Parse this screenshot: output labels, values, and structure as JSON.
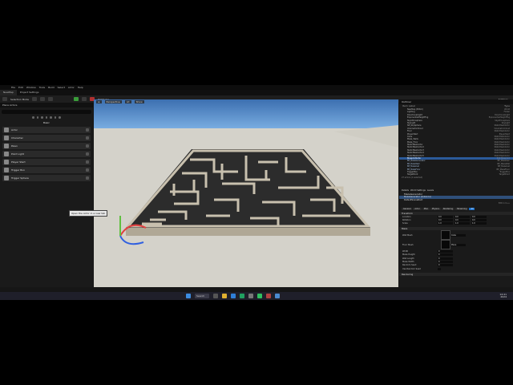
{
  "window": {
    "project": "UnrealEditor",
    "menu": [
      "File",
      "Edit",
      "Window",
      "Tools",
      "Build",
      "Select",
      "Actor",
      "Help"
    ],
    "tabs": [
      "NewMap",
      "Project Settings"
    ],
    "active_tab": "NewMap"
  },
  "toolbar": {
    "mode_label": "Selection Mode",
    "platforms_label": "Platforms",
    "settings_label": "Settings"
  },
  "place_actors": {
    "title": "Place Actors",
    "section": "Basic",
    "items": [
      {
        "label": "Actor",
        "icon": "actor-icon"
      },
      {
        "label": "Character",
        "icon": "character-icon"
      },
      {
        "label": "Pawn",
        "icon": "pawn-icon"
      },
      {
        "label": "Point Light",
        "icon": "point-light-icon"
      },
      {
        "label": "Player Start",
        "icon": "player-start-icon"
      },
      {
        "label": "Trigger Box",
        "icon": "trigger-box-icon"
      },
      {
        "label": "Trigger Sphere",
        "icon": "trigger-sphere-icon"
      }
    ],
    "tooltip": "Open the Actor in a new tab"
  },
  "viewport": {
    "perspective_label": "Perspective",
    "lit_label": "Lit",
    "show_label": "Show"
  },
  "outliner": {
    "title": "Outliner",
    "col_label": "Item Label",
    "col_type": "Type",
    "rows": [
      {
        "label": "NewMap (Editor)",
        "type": "World",
        "state": ""
      },
      {
        "label": "Lighting",
        "type": "Folder",
        "state": ""
      },
      {
        "label": "DirectionalLight",
        "type": "DirectionalLight",
        "state": ""
      },
      {
        "label": "ExponentialHeightFog",
        "type": "ExponentialHeightFog",
        "state": ""
      },
      {
        "label": "SkyAtmosphere",
        "type": "SkyAtmosphere",
        "state": ""
      },
      {
        "label": "SkyLight",
        "type": "SkyLight",
        "state": ""
      },
      {
        "label": "SM_SkySphere",
        "type": "StaticMeshActor",
        "state": ""
      },
      {
        "label": "VolumetricCloud",
        "type": "VolumetricCloud",
        "state": ""
      },
      {
        "label": "Floor",
        "type": "StaticMeshActor",
        "state": ""
      },
      {
        "label": "PlayerStart",
        "type": "PlayerStart",
        "state": ""
      },
      {
        "label": "Cube",
        "type": "StaticMeshActor",
        "state": ""
      },
      {
        "label": "Maze_Walls",
        "type": "StaticMeshActor",
        "state": ""
      },
      {
        "label": "Maze_Floor",
        "type": "StaticMeshActor",
        "state": ""
      },
      {
        "label": "StaticMeshActor",
        "type": "StaticMeshActor",
        "state": ""
      },
      {
        "label": "StaticMeshActor2",
        "type": "StaticMeshActor",
        "state": ""
      },
      {
        "label": "StaticMeshActor3",
        "type": "StaticMeshActor",
        "state": ""
      },
      {
        "label": "StaticMeshActor4",
        "type": "StaticMeshActor",
        "state": ""
      },
      {
        "label": "StaticMeshActor5",
        "type": "StaticMeshActor",
        "state": ""
      },
      {
        "label": "BlueprintActor",
        "type": "Edit Blueprint",
        "state": "sel"
      },
      {
        "label": "BP_MazeGenerator",
        "type": "BP_MazeGen",
        "state": "dim"
      },
      {
        "label": "BP_MazeWall",
        "type": "BP_MazeWall",
        "state": "dim"
      },
      {
        "label": "BP_MazeCell",
        "type": "BP_MazeCell",
        "state": "dim"
      },
      {
        "label": "BP_MazeFloor",
        "type": "BP_MazeFloor",
        "state": "dim"
      },
      {
        "label": "TriggerBox",
        "type": "TriggerBox",
        "state": ""
      },
      {
        "label": "TargetPoint",
        "type": "TargetPoint",
        "state": ""
      }
    ],
    "footer": "27 actors (1 selected)"
  },
  "details": {
    "tabs": [
      "Details",
      "World Settings",
      "Levels"
    ],
    "actor_name": "MazeGenerator",
    "components": [
      {
        "label": "MazeGenerator (Instance)",
        "state": "sel"
      },
      {
        "label": "DefaultSceneRoot",
        "state": ""
      }
    ],
    "edit_in": "Edit in C++",
    "categories": [
      "All",
      "General",
      "Actor",
      "Misc",
      "Physics",
      "Rendering",
      "Streaming"
    ],
    "active_category": "All",
    "transform": {
      "section": "Transform",
      "location_label": "Location",
      "rotation_label": "Rotation",
      "scale_label": "Scale",
      "location": [
        "0.0",
        "0.0",
        "0.0"
      ],
      "rotation": [
        "0.0",
        "0.0",
        "0.0"
      ],
      "scale": [
        "1.0",
        "1.0",
        "1.0"
      ]
    },
    "maze_section": "Maze",
    "maze_props": [
      {
        "label": "Wall Mesh",
        "value": "Cube"
      },
      {
        "label": "Floor Mesh",
        "value": "Plane"
      },
      {
        "label": "Width",
        "value": "0"
      },
      {
        "label": "Maze Height",
        "value": "0"
      },
      {
        "label": "Wall Length",
        "value": "0"
      },
      {
        "label": "Maze Width",
        "value": "0"
      },
      {
        "label": "Random Seed",
        "value": "0"
      },
      {
        "label": "Use Random Seed",
        "value": ""
      }
    ],
    "rendering_section": "Rendering"
  },
  "bottom_bar": {
    "content_drawer": "Content Drawer",
    "output_log": "Output Log",
    "cmd": "Cmd",
    "source_control": "Source Control"
  },
  "taskbar": {
    "search": "Search",
    "time": "14:41",
    "date": "2024"
  }
}
